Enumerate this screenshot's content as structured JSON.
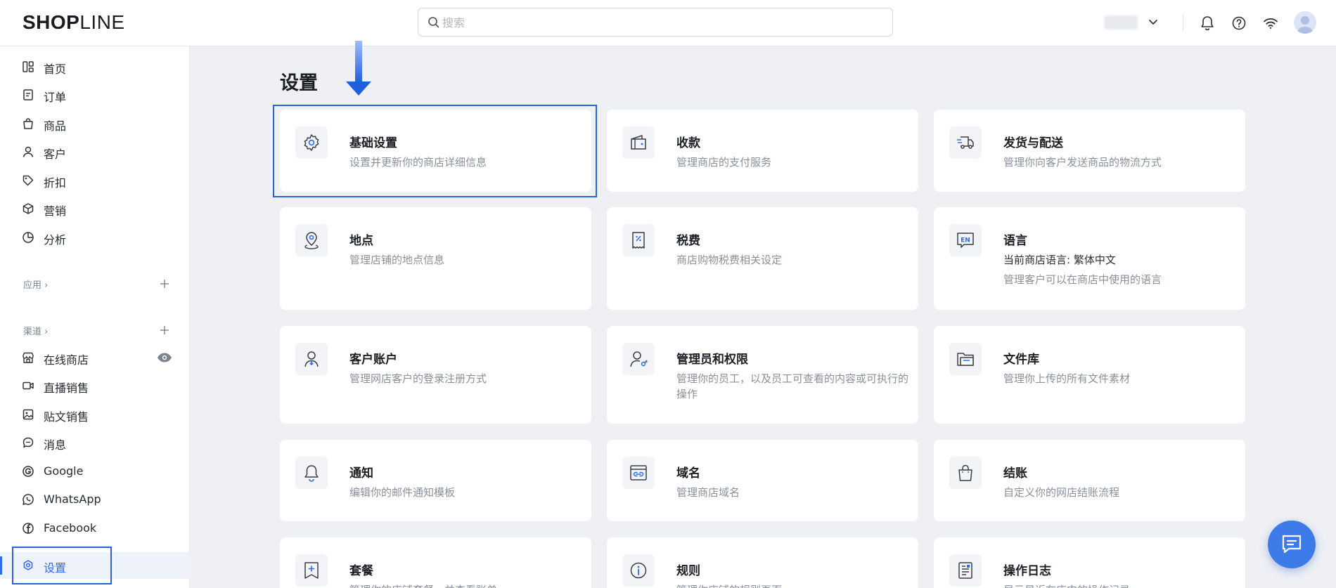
{
  "brand": {
    "logo_bold": "SHOP",
    "logo_rest": "LINE"
  },
  "search": {
    "placeholder": "搜索"
  },
  "sidebar": {
    "items": [
      {
        "label": "首页",
        "icon": "dashboard-icon"
      },
      {
        "label": "订单",
        "icon": "order-icon"
      },
      {
        "label": "商品",
        "icon": "bag-icon"
      },
      {
        "label": "客户",
        "icon": "person-icon"
      },
      {
        "label": "折扣",
        "icon": "tag-icon"
      },
      {
        "label": "营销",
        "icon": "cube-icon"
      },
      {
        "label": "分析",
        "icon": "chart-pie-icon"
      }
    ],
    "apps_label": "应用 ›",
    "channels_label": "渠道 ›",
    "channels": [
      {
        "label": "在线商店",
        "icon": "store-icon"
      },
      {
        "label": "直播销售",
        "icon": "video-icon"
      },
      {
        "label": "贴文销售",
        "icon": "image-post-icon"
      },
      {
        "label": "消息",
        "icon": "chat-icon"
      },
      {
        "label": "Google",
        "icon": "google-icon"
      },
      {
        "label": "WhatsApp",
        "icon": "whatsapp-icon"
      },
      {
        "label": "Facebook",
        "icon": "facebook-icon"
      }
    ],
    "settings_label": "设置"
  },
  "main": {
    "title": "设置",
    "cards": [
      {
        "title": "基础设置",
        "desc": "设置并更新你的商店详细信息",
        "icon": "gear-icon"
      },
      {
        "title": "收款",
        "desc": "管理商店的支付服务",
        "icon": "wallet-icon"
      },
      {
        "title": "发货与配送",
        "desc": "管理你向客户发送商品的物流方式",
        "icon": "truck-icon"
      },
      {
        "title": "地点",
        "desc": "管理店铺的地点信息",
        "icon": "location-icon"
      },
      {
        "title": "税费",
        "desc": "商店购物税费相关设定",
        "icon": "receipt-icon"
      },
      {
        "title": "语言",
        "desc": "当前商店语言: 繁体中文",
        "desc2": "管理客户可以在商店中使用的语言",
        "icon": "language-icon"
      },
      {
        "title": "客户账户",
        "desc": "管理网店客户的登录注册方式",
        "icon": "customer-account-icon"
      },
      {
        "title": "管理员和权限",
        "desc": "管理你的员工，以及员工可查看的内容或可执行的操作",
        "icon": "admin-key-icon"
      },
      {
        "title": "文件库",
        "desc": "管理你上传的所有文件素材",
        "icon": "folder-icon"
      },
      {
        "title": "通知",
        "desc": "编辑你的邮件通知模板",
        "icon": "bell-icon"
      },
      {
        "title": "域名",
        "desc": "管理商店域名",
        "icon": "domain-link-icon"
      },
      {
        "title": "结账",
        "desc": "自定义你的网店结账流程",
        "icon": "shopping-bag-icon"
      },
      {
        "title": "套餐",
        "desc": "管理你的店铺套餐，并查看账单",
        "icon": "plan-icon"
      },
      {
        "title": "规则",
        "desc": "管理你店铺的规则页面",
        "icon": "info-icon"
      },
      {
        "title": "操作日志",
        "desc": "显示最近在店中的操作记录",
        "icon": "log-icon"
      }
    ]
  },
  "colors": {
    "accent": "#2f6be6",
    "highlight": "#2a62d8",
    "fab": "#3d7be8"
  }
}
